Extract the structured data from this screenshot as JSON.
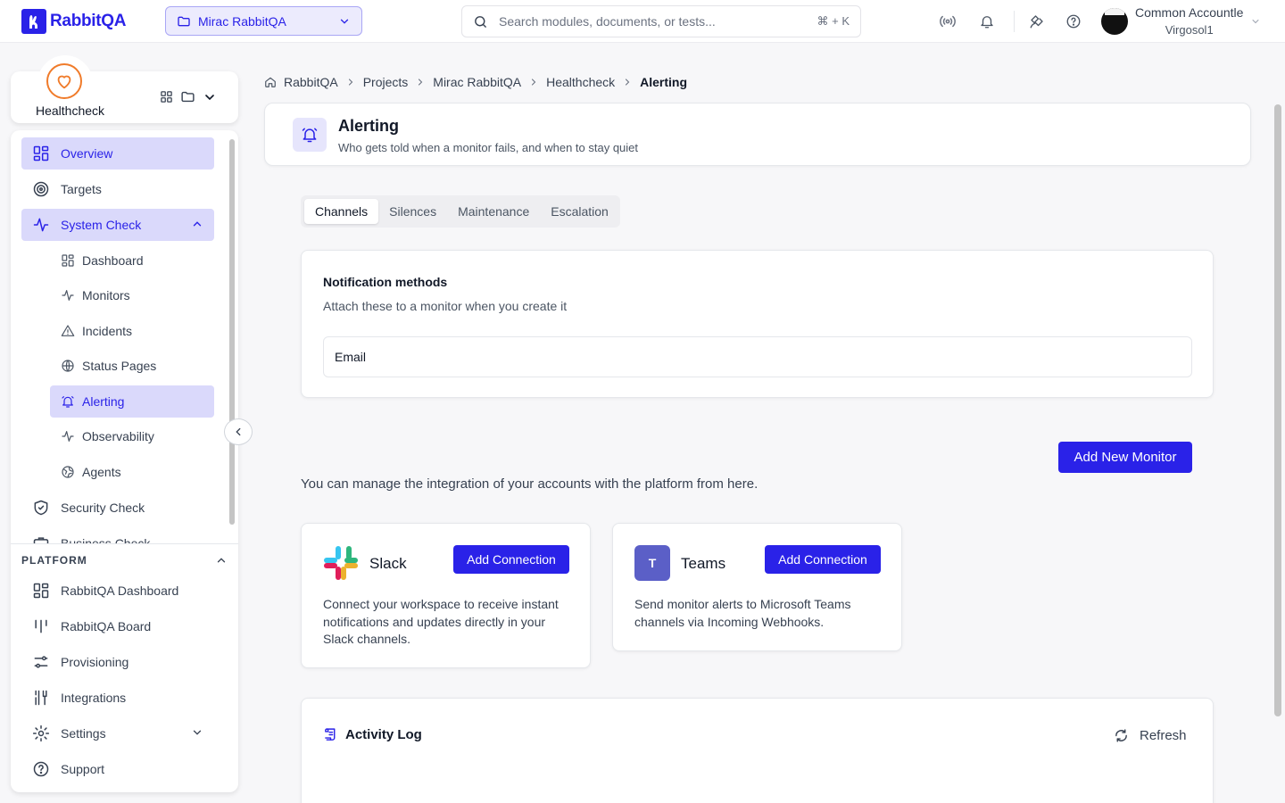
{
  "app": {
    "logo_text": "RabbitQA"
  },
  "header": {
    "project": "Mirac RabbitQA",
    "search_placeholder": "Search modules, documents, or tests...",
    "shortcut": "⌘ + K",
    "user_name": "Common Accountle",
    "user_org": "Virgosol1"
  },
  "module": {
    "label": "Healthcheck"
  },
  "sidebar": {
    "items": [
      {
        "label": "Overview"
      },
      {
        "label": "Targets"
      },
      {
        "label": "System Check"
      },
      {
        "label": "Dashboard"
      },
      {
        "label": "Monitors"
      },
      {
        "label": "Incidents"
      },
      {
        "label": "Status Pages"
      },
      {
        "label": "Alerting"
      },
      {
        "label": "Observability"
      },
      {
        "label": "Agents"
      },
      {
        "label": "Security Check"
      },
      {
        "label": "Business Check"
      }
    ],
    "platform_header": "PLATFORM",
    "platform_items": [
      {
        "label": "RabbitQA Dashboard"
      },
      {
        "label": "RabbitQA Board"
      },
      {
        "label": "Provisioning"
      },
      {
        "label": "Integrations"
      },
      {
        "label": "Settings"
      },
      {
        "label": "Support"
      }
    ]
  },
  "breadcrumb": [
    "RabbitQA",
    "Projects",
    "Mirac RabbitQA",
    "Healthcheck",
    "Alerting"
  ],
  "page": {
    "title": "Alerting",
    "subtitle": "Who gets told when a monitor fails, and when to stay quiet"
  },
  "tabs": [
    "Channels",
    "Silences",
    "Maintenance",
    "Escalation"
  ],
  "notification": {
    "title": "Notification methods",
    "subtitle": "Attach these to a monitor when you create it",
    "methods": [
      "Email"
    ]
  },
  "add_monitor_label": "Add New Monitor",
  "integrations": {
    "intro": "You can manage the integration of your accounts with the platform from here.",
    "items": [
      {
        "name": "Slack",
        "button": "Add Connection",
        "description": "Connect your workspace to receive instant notifications and updates directly in your Slack channels."
      },
      {
        "name": "Teams",
        "logo_letter": "T",
        "button": "Add Connection",
        "description": "Send monitor alerts to Microsoft Teams channels via Incoming Webhooks."
      }
    ]
  },
  "activity": {
    "title": "Activity Log",
    "refresh_label": "Refresh"
  },
  "colors": {
    "accent": "#2a22e8",
    "accent_soft": "#dad9fb",
    "module_orange": "#f07b2a",
    "teams": "#5b5fc7"
  }
}
